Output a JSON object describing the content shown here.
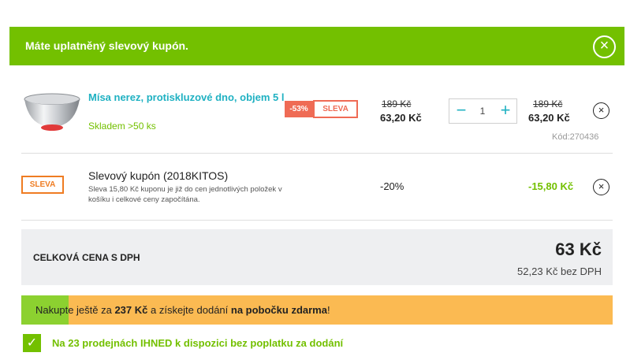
{
  "banner": {
    "text": "Máte uplatněný slevový kupón.",
    "close_icon": "×"
  },
  "product": {
    "name": "Mísa nerez, protiskluzové dno, objem 5 l",
    "stock": "Skladem >50 ks",
    "discount_badge": "-53%",
    "sleva_badge": "SLEVA",
    "unit_old_price": "189 Kč",
    "unit_price": "63,20 Kč",
    "quantity": "1",
    "minus_label": "−",
    "plus_label": "+",
    "total_old_price": "189 Kč",
    "total_price": "63,20 Kč",
    "code": "Kód:270436",
    "remove_icon": "×"
  },
  "coupon": {
    "badge": "SLEVA",
    "title": "Slevový kupón (2018KITOS)",
    "description": "Sleva 15,80 Kč kuponu je již do cen jednotlivých položek v košíku i celkové ceny započítána.",
    "percent": "-20%",
    "amount": "-15,80 Kč",
    "remove_icon": "×"
  },
  "total": {
    "label": "CELKOVÁ CENA S DPH",
    "price": "63 Kč",
    "net": "52,23 Kč bez DPH"
  },
  "shipping": {
    "progress": 0.08,
    "text_before": "Nakupte ještě za ",
    "amount": "237 Kč",
    "text_middle": " a získejte dodání ",
    "bold_end": "na pobočku zdarma",
    "text_end": "!"
  },
  "availability": {
    "check_icon": "✓",
    "text": "Na 23 prodejnách IHNED k dispozici bez poplatku za dodání"
  },
  "colors": {
    "brand_green": "#73c000",
    "accent_teal": "#1fb1c2",
    "sale_red": "#ef6b55",
    "sale_orange": "#ef7c22",
    "progress_orange": "#fbba52",
    "progress_green": "#8cd130"
  }
}
